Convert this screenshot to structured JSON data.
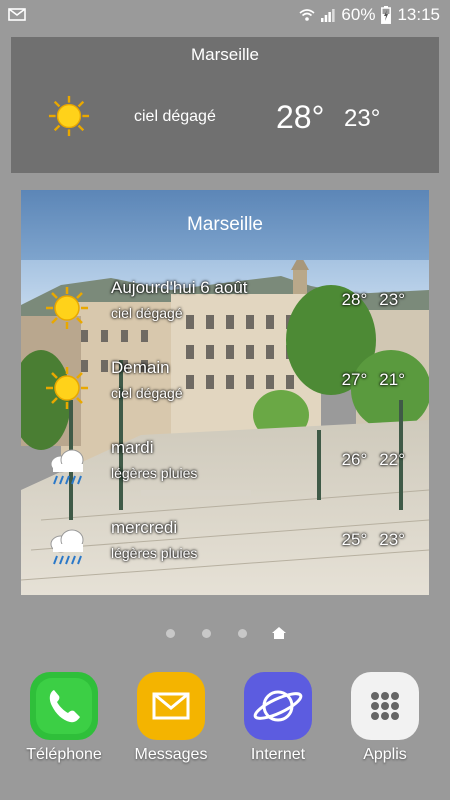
{
  "status_bar": {
    "battery": "60%",
    "time": "13:15",
    "icons": [
      "email-notification-icon",
      "wifi-icon",
      "signal-icon",
      "battery-charging-icon"
    ]
  },
  "widget_small": {
    "city": "Marseille",
    "condition": "ciel dégagé",
    "high": "28°",
    "low": "23°",
    "icon": "sun-icon"
  },
  "widget_forecast": {
    "city": "Marseille",
    "days": [
      {
        "day": "Aujourd'hui 6 août",
        "desc": "ciel dégagé",
        "high": "28°",
        "low": "23°",
        "icon": "sun-icon"
      },
      {
        "day": "Demain",
        "desc": "ciel dégagé",
        "high": "27°",
        "low": "21°",
        "icon": "sun-icon"
      },
      {
        "day": "mardi",
        "desc": "légères pluies",
        "high": "26°",
        "low": "22°",
        "icon": "rain-cloud-icon"
      },
      {
        "day": "mercredi",
        "desc": "légères pluies",
        "high": "25°",
        "low": "23°",
        "icon": "rain-cloud-icon"
      }
    ]
  },
  "page_indicator": {
    "pages": 4,
    "current": 4
  },
  "dock": [
    {
      "label": "Téléphone",
      "icon": "phone-icon",
      "color": "#2fbf3a"
    },
    {
      "label": "Messages",
      "icon": "envelope-icon",
      "color": "#f4b400"
    },
    {
      "label": "Internet",
      "icon": "globe-icon",
      "color": "#5c5ce0"
    },
    {
      "label": "Applis",
      "icon": "apps-grid-icon",
      "color": "#f2f2f2"
    }
  ]
}
